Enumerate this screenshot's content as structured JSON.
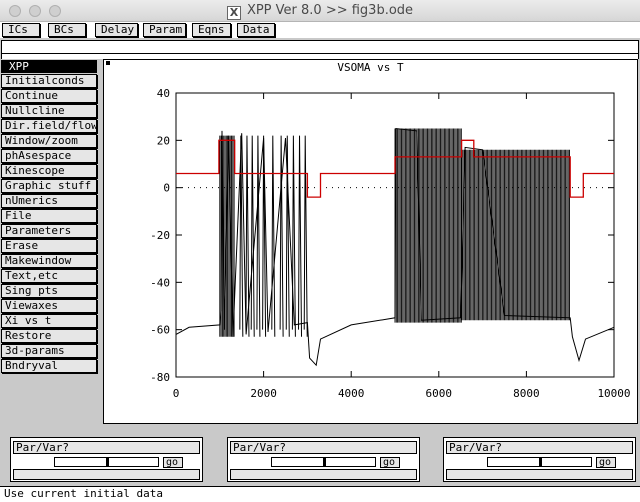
{
  "window": {
    "title": "XPP Ver 8.0 >> fig3b.ode"
  },
  "toolbar": {
    "buttons": [
      "ICs",
      "BCs",
      "Delay",
      "Param",
      "Eqns",
      "Data"
    ]
  },
  "menu": {
    "header": "XPP",
    "items": [
      "Initialconds",
      "Continue",
      "Nullcline",
      "Dir.field/flow",
      "Window/zoom",
      "phAsespace",
      "Kinescope",
      "Graphic stuff",
      "nUmerics",
      "File",
      "Parameters",
      "Erase",
      "Makewindow",
      "Text,etc",
      "Sing pts",
      "Viewaxes",
      "Xi vs t",
      "Restore",
      "3d-params",
      "Bndryval"
    ]
  },
  "graph": {
    "title": "VSOMA vs T",
    "yticks": [
      "40",
      "20",
      "0",
      "-20",
      "-40",
      "-60",
      "-80"
    ],
    "xticks": [
      "0",
      "2000",
      "4000",
      "6000",
      "8000",
      "10000"
    ]
  },
  "chart_data": {
    "type": "line",
    "title": "VSOMA vs T",
    "xlim": [
      0,
      10000
    ],
    "ylim": [
      -80,
      40
    ],
    "xticks": [
      0,
      2000,
      4000,
      6000,
      8000,
      10000
    ],
    "yticks": [
      40,
      20,
      0,
      -20,
      -40,
      -60,
      -80
    ],
    "grid": false,
    "zero_line": "dotted",
    "series": [
      {
        "color": "#000000",
        "values": [
          [
            0,
            -62
          ],
          [
            300,
            -59
          ],
          [
            1000,
            -58
          ],
          [
            1030,
            -52
          ],
          [
            1050,
            24
          ],
          [
            1100,
            -60
          ],
          [
            1200,
            22
          ],
          [
            1300,
            -63
          ],
          [
            1500,
            23
          ],
          [
            1600,
            -62
          ],
          [
            2000,
            21
          ],
          [
            2100,
            -61
          ],
          [
            2500,
            21
          ],
          [
            2700,
            -58
          ],
          [
            3000,
            -57
          ],
          [
            3050,
            -72
          ],
          [
            3200,
            -75
          ],
          [
            3300,
            -64
          ],
          [
            4000,
            -58
          ],
          [
            5000,
            -55
          ],
          [
            5020,
            25
          ],
          [
            5500,
            24
          ],
          [
            5600,
            -56
          ],
          [
            6500,
            -55
          ],
          [
            6600,
            17
          ],
          [
            7000,
            16
          ],
          [
            7500,
            -54
          ],
          [
            9000,
            -55
          ],
          [
            9050,
            -63
          ],
          [
            9200,
            -73
          ],
          [
            9350,
            -64
          ],
          [
            10000,
            -59
          ]
        ],
        "spiking_bands": [
          {
            "x_from": 1000,
            "x_to": 1330,
            "v_max": 22,
            "v_min": -63
          },
          {
            "x_from": 5000,
            "x_to": 6520,
            "v_max": 25,
            "v_min": -57
          },
          {
            "x_from": 6520,
            "x_to": 9000,
            "v_max": 16,
            "v_min": -56
          }
        ],
        "spikes": [
          1480,
          1620,
          1740,
          1870,
          2000,
          2210,
          2400,
          2540,
          2680,
          2820,
          2950
        ]
      },
      {
        "color": "#cc0000",
        "values": [
          [
            0,
            6
          ],
          [
            980,
            6
          ],
          [
            980,
            20
          ],
          [
            1340,
            20
          ],
          [
            1340,
            6
          ],
          [
            3000,
            6
          ],
          [
            3000,
            -4
          ],
          [
            3300,
            -4
          ],
          [
            3300,
            6
          ],
          [
            5000,
            6
          ],
          [
            5000,
            13
          ],
          [
            6520,
            13
          ],
          [
            6520,
            20
          ],
          [
            6800,
            20
          ],
          [
            6800,
            13
          ],
          [
            9000,
            13
          ],
          [
            9000,
            -4
          ],
          [
            9300,
            -4
          ],
          [
            9300,
            6
          ],
          [
            10000,
            6
          ]
        ]
      }
    ]
  },
  "params": [
    {
      "label": "Par/Var?",
      "go": "go",
      "slider": 0.5
    },
    {
      "label": "Par/Var?",
      "go": "go",
      "slider": 0.5
    },
    {
      "label": "Par/Var?",
      "go": "go",
      "slider": 0.5
    }
  ],
  "status": "Use current initial data"
}
